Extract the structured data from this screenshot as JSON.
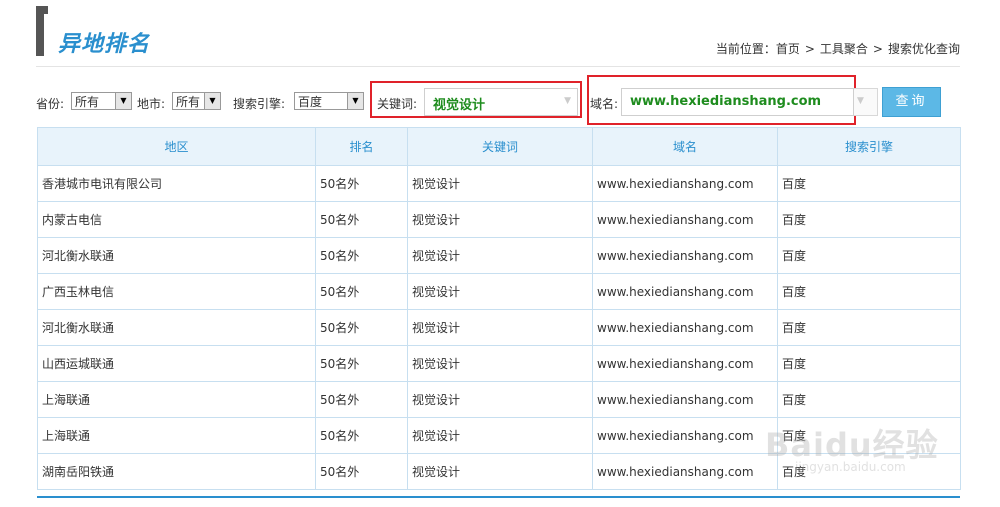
{
  "header": {
    "title": "异地排名",
    "breadcrumb_prefix": "当前位置：",
    "breadcrumb": [
      "首页",
      "工具聚合",
      "搜索优化查询"
    ],
    "breadcrumb_sep": ">"
  },
  "filters": {
    "province_label": "省份:",
    "province_value": "所有",
    "city_label": "地市:",
    "city_value": "所有",
    "engine_label": "搜索引擎:",
    "engine_value": "百度",
    "keyword_label": "关键词:",
    "keyword_value": "视觉设计",
    "domain_label": "域名:",
    "domain_value": "www.hexiedianshang.com",
    "query_label": "查询"
  },
  "table": {
    "columns": [
      "地区",
      "排名",
      "关键词",
      "域名",
      "搜索引擎"
    ],
    "rows": [
      [
        "香港城市电讯有限公司",
        "50名外",
        "视觉设计",
        "www.hexiedianshang.com",
        "百度"
      ],
      [
        "内蒙古电信",
        "50名外",
        "视觉设计",
        "www.hexiedianshang.com",
        "百度"
      ],
      [
        "河北衡水联通",
        "50名外",
        "视觉设计",
        "www.hexiedianshang.com",
        "百度"
      ],
      [
        "广西玉林电信",
        "50名外",
        "视觉设计",
        "www.hexiedianshang.com",
        "百度"
      ],
      [
        "河北衡水联通",
        "50名外",
        "视觉设计",
        "www.hexiedianshang.com",
        "百度"
      ],
      [
        "山西运城联通",
        "50名外",
        "视觉设计",
        "www.hexiedianshang.com",
        "百度"
      ],
      [
        "上海联通",
        "50名外",
        "视觉设计",
        "www.hexiedianshang.com",
        "百度"
      ],
      [
        "上海联通",
        "50名外",
        "视觉设计",
        "www.hexiedianshang.com",
        "百度"
      ],
      [
        "湖南岳阳铁通",
        "50名外",
        "视觉设计",
        "www.hexiedianshang.com",
        "百度"
      ]
    ]
  },
  "watermark": {
    "text": "Baidu经验",
    "url": "jingyan.baidu.com"
  },
  "colors": {
    "accent": "#2a8fce",
    "highlight_box": "#e0222a",
    "value_green": "#1e8c1e",
    "button": "#5cb8e6"
  }
}
